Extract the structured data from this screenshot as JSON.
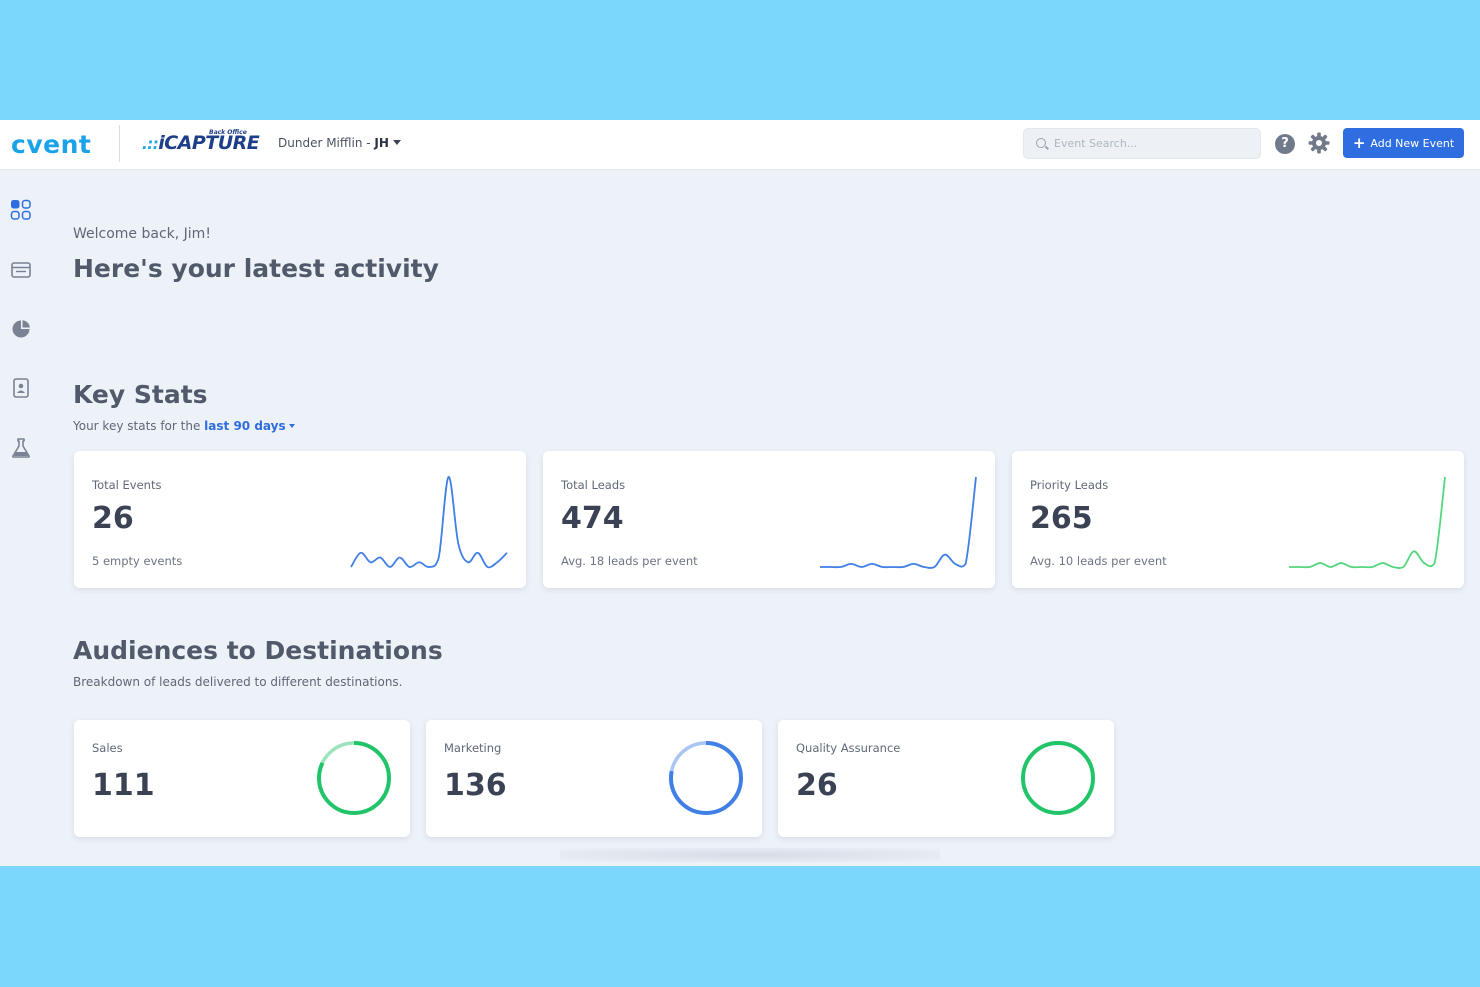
{
  "header": {
    "brand": "cvent",
    "product_logo": "iCAPTURE",
    "product_tag": "Back Office",
    "org_name": "Dunder Mifflin",
    "org_separator": " - ",
    "user_initials": "JH",
    "search_placeholder": "Event Search...",
    "help_glyph": "?",
    "add_button_label": "Add New Event",
    "add_button_glyph": "+",
    "accent_color": "#2f6ee0"
  },
  "sidebar": {
    "items": [
      {
        "icon": "dashboard-icon",
        "active": true
      },
      {
        "icon": "calendar-icon"
      },
      {
        "icon": "pie-chart-icon"
      },
      {
        "icon": "contact-card-icon"
      },
      {
        "icon": "flask-icon"
      }
    ]
  },
  "main": {
    "welcome": "Welcome back, Jim!",
    "title": "Here's your latest activity"
  },
  "key_stats": {
    "title": "Key Stats",
    "subtitle_prefix": "Your key stats for the",
    "range_label": "last 90 days",
    "cards": [
      {
        "label": "Total Events",
        "value": "26",
        "note": "5 empty events",
        "color": "#3f7fe6"
      },
      {
        "label": "Total Leads",
        "value": "474",
        "note": "Avg. 18 leads per event",
        "color": "#3f7fe6"
      },
      {
        "label": "Priority Leads",
        "value": "265",
        "note": "Avg. 10 leads per event",
        "color": "#55d67e"
      }
    ]
  },
  "audiences": {
    "title": "Audiences to Destinations",
    "subtitle": "Breakdown of leads delivered to different destinations.",
    "cards": [
      {
        "label": "Sales",
        "value": "111",
        "color": "#22c46a",
        "fill": 0.82
      },
      {
        "label": "Marketing",
        "value": "136",
        "color": "#3f7fe6",
        "fill": 0.78
      },
      {
        "label": "Quality Assurance",
        "value": "26",
        "color": "#22c46a",
        "fill": 1.0
      }
    ]
  },
  "chart_data": [
    {
      "type": "line",
      "series": [
        {
          "values": [
            1,
            4,
            2,
            3,
            1,
            3,
            1,
            2,
            1,
            3,
            20,
            6,
            2,
            4,
            1,
            2,
            4
          ]
        }
      ]
    },
    {
      "type": "line",
      "series": [
        {
          "values": [
            1,
            1,
            1,
            2,
            1,
            2,
            1,
            1,
            1,
            2,
            1,
            1,
            5,
            2,
            2,
            30
          ]
        }
      ]
    },
    {
      "type": "line",
      "series": [
        {
          "values": [
            1,
            1,
            1,
            2,
            1,
            2,
            1,
            1,
            1,
            2,
            1,
            1,
            5,
            2,
            2,
            24
          ]
        }
      ]
    }
  ]
}
